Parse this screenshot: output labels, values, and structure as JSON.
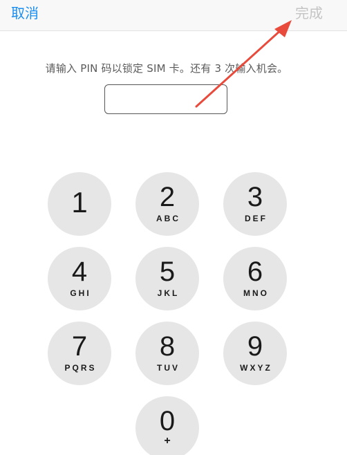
{
  "nav": {
    "cancel_label": "取消",
    "done_label": "完成"
  },
  "prompt": {
    "text": "请输入 PIN 码以锁定 SIM 卡。还有 3 次输入机会。"
  },
  "pin_input": {
    "value": ""
  },
  "keypad": {
    "keys": [
      {
        "digit": "1",
        "letters": ""
      },
      {
        "digit": "2",
        "letters": "ABC"
      },
      {
        "digit": "3",
        "letters": "DEF"
      },
      {
        "digit": "4",
        "letters": "GHI"
      },
      {
        "digit": "5",
        "letters": "JKL"
      },
      {
        "digit": "6",
        "letters": "MNO"
      },
      {
        "digit": "7",
        "letters": "PQRS"
      },
      {
        "digit": "8",
        "letters": "TUV"
      },
      {
        "digit": "9",
        "letters": "WXYZ"
      },
      {
        "digit": "0",
        "letters": "+"
      }
    ]
  },
  "annotation": {
    "arrow_icon": "red-arrow-icon",
    "color": "#e84a3c"
  },
  "colors": {
    "accent": "#1a8ef0",
    "disabled": "#c4c4c4",
    "key_background": "#e6e6e6"
  }
}
